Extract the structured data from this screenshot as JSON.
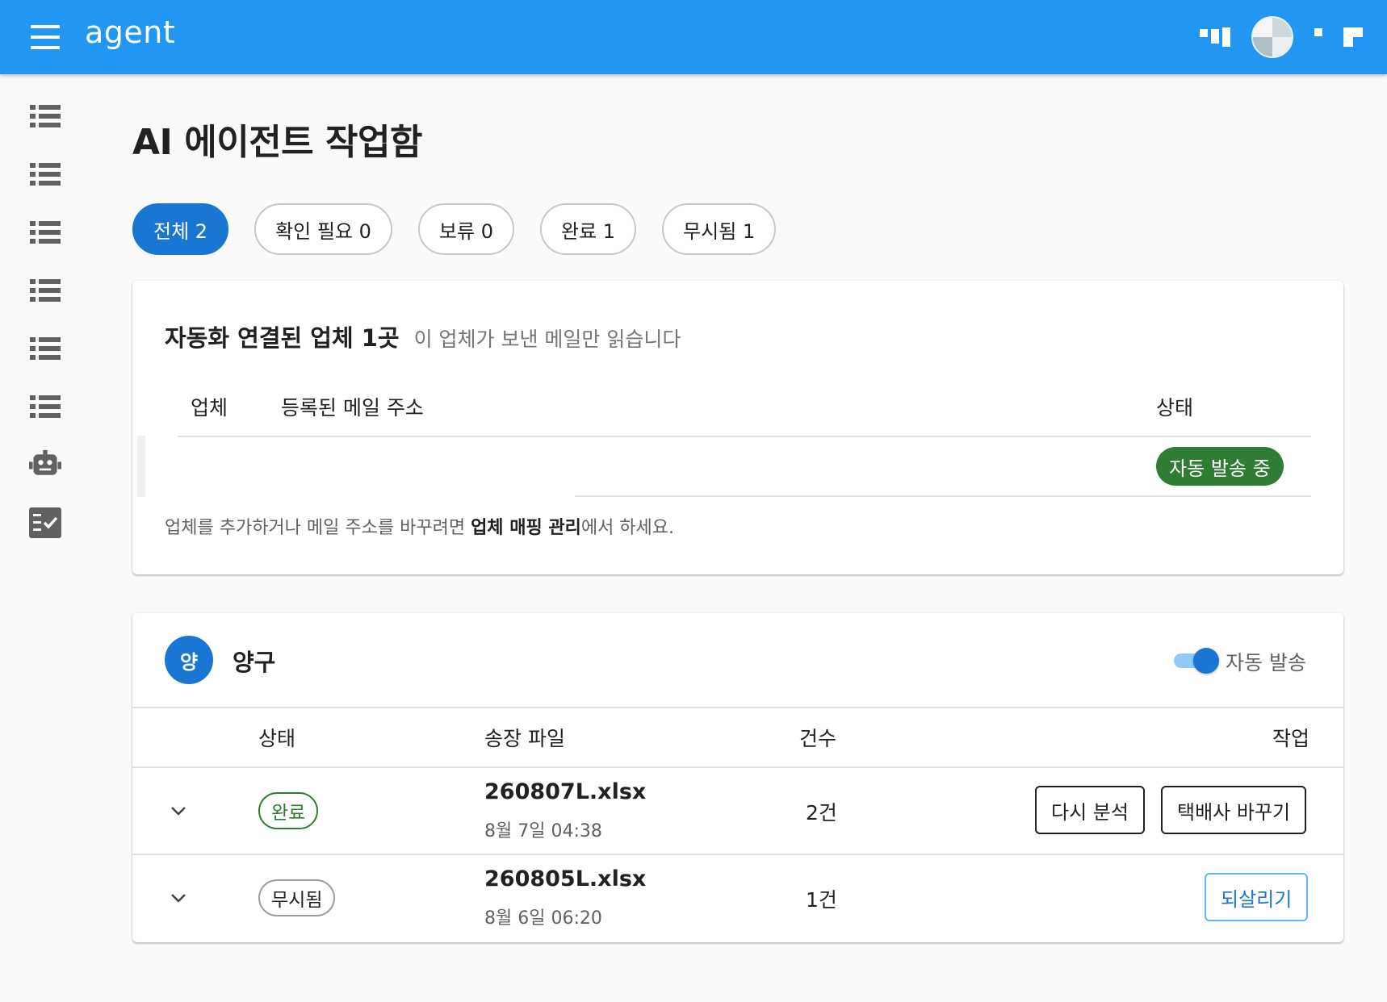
{
  "appbar": {
    "title": "agent"
  },
  "rail": {
    "items": [
      "list-icon",
      "list-icon",
      "list-icon",
      "list-icon",
      "list-icon",
      "list-icon",
      "robot-icon",
      "checklist-icon"
    ]
  },
  "page": {
    "title": "AI 에이전트 작업함"
  },
  "filters": [
    {
      "label": "전체 2",
      "active": true
    },
    {
      "label": "확인 필요 0",
      "active": false
    },
    {
      "label": "보류 0",
      "active": false
    },
    {
      "label": "완료 1",
      "active": false
    },
    {
      "label": "무시됨 1",
      "active": false
    }
  ],
  "linked_vendors": {
    "heading": "자동화 연결된 업체 1곳",
    "subheading": "이 업체가 보낸 메일만 읽습니다",
    "columns": {
      "vendor": "업체",
      "email": "등록된 메일 주소",
      "status": "상태"
    },
    "rows": [
      {
        "vendor": "",
        "email": "",
        "status": "자동 발송 중"
      }
    ],
    "note_prefix": "업체를 추가하거나 메일 주소를 바꾸려면 ",
    "note_link": "업체 매핑 관리",
    "note_suffix": "에서 하세요."
  },
  "vendor_card": {
    "avatar_text": "양",
    "name": "양구",
    "auto_send_label": "자동 발송",
    "auto_send_on": true,
    "columns": {
      "status": "상태",
      "file": "송장 파일",
      "count": "건수",
      "action": "작업"
    },
    "rows": [
      {
        "status": "완료",
        "file": "260807L.xlsx",
        "date": "8월 7일 04:38",
        "count": "2건",
        "actions": [
          "다시 분석",
          "택배사 바꾸기"
        ]
      },
      {
        "status": "무시됨",
        "file": "260805L.xlsx",
        "date": "8월 6일 06:20",
        "count": "1건",
        "actions": [
          "되살리기"
        ]
      }
    ]
  },
  "colors": {
    "primary": "#2196f3",
    "accent": "#1976d2",
    "success": "#2e7d32"
  }
}
